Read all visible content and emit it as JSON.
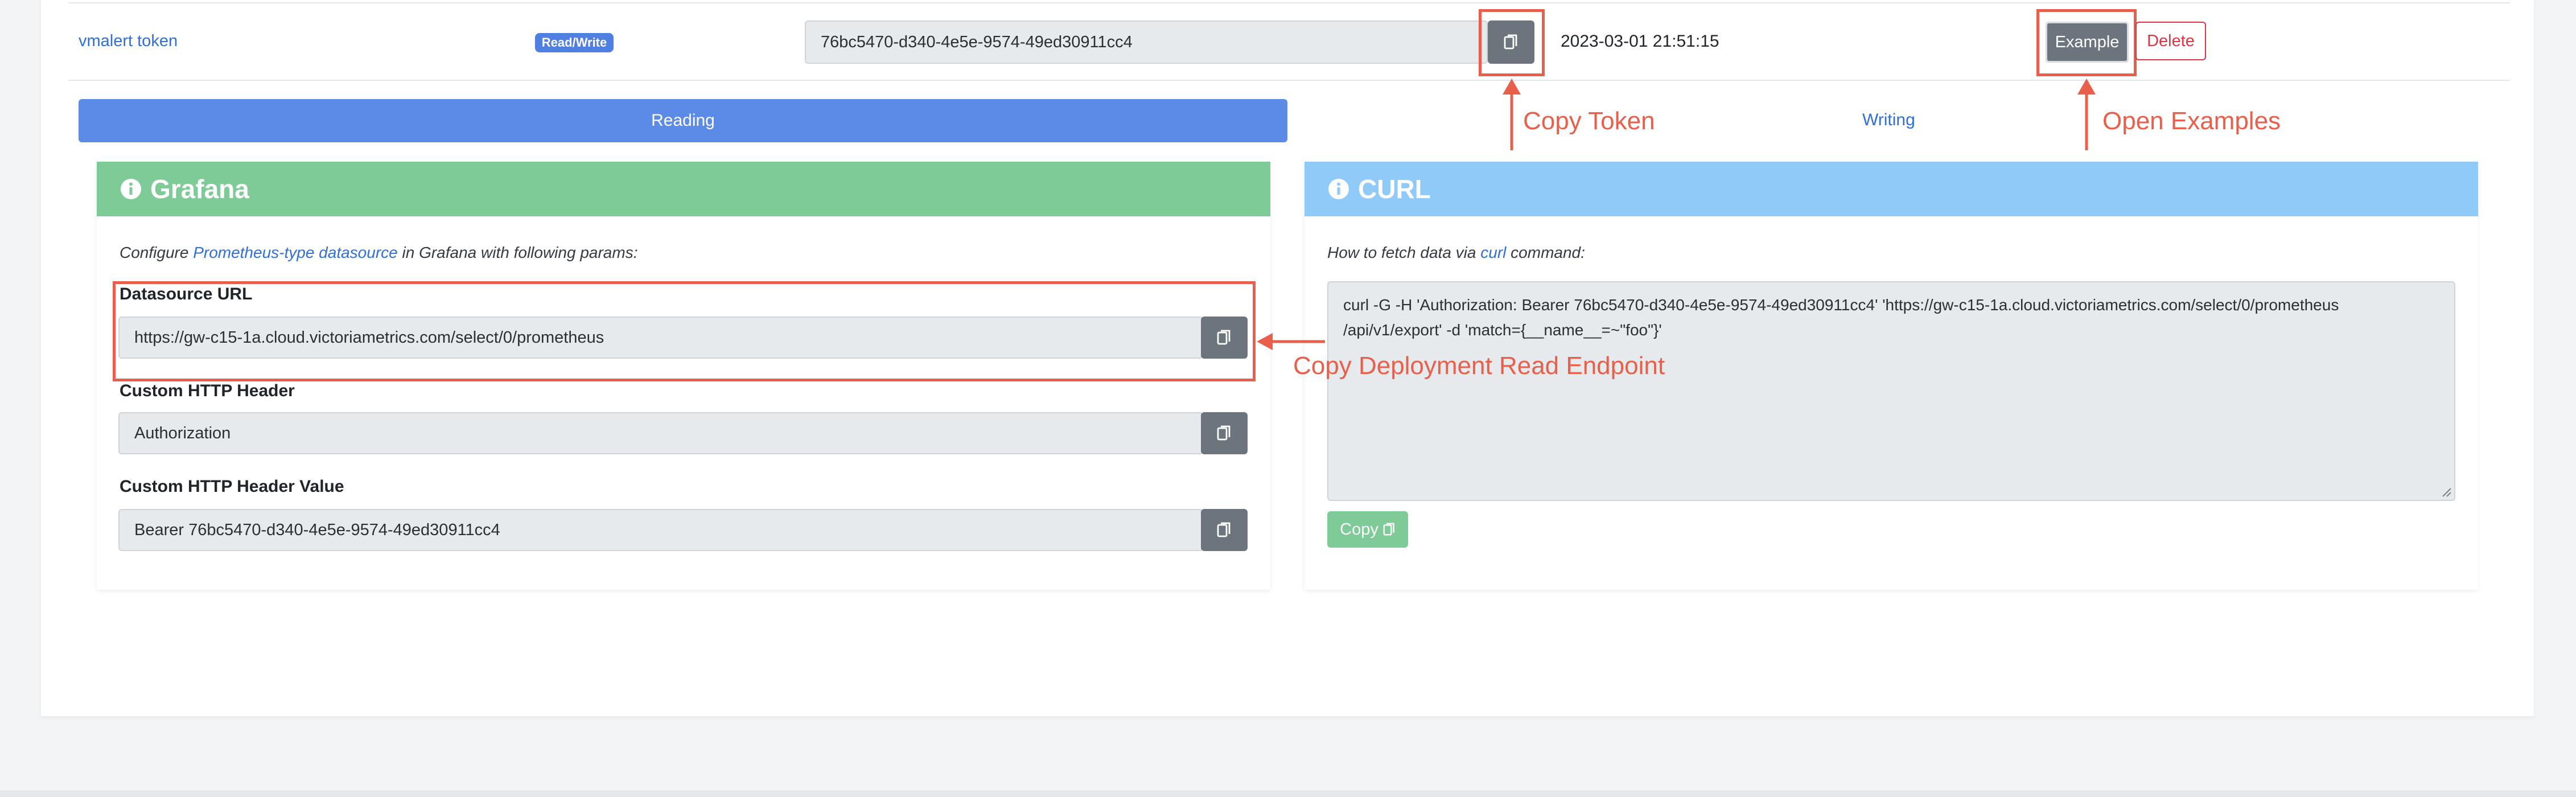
{
  "token_row": {
    "name": "vmalert token",
    "access_badge": "Read/Write",
    "token_value": "76bc5470-d340-4e5e-9574-49ed30911cc4",
    "created": "2023-03-01 21:51:15",
    "example_label": "Example",
    "delete_label": "Delete"
  },
  "tabs": {
    "reading": "Reading",
    "writing": "Writing"
  },
  "grafana": {
    "title": "Grafana",
    "desc_prefix": "Configure ",
    "desc_link": "Prometheus-type datasource",
    "desc_suffix": " in Grafana with following params:",
    "fields": [
      {
        "label": "Datasource URL",
        "value": "https://gw-c15-1a.cloud.victoriametrics.com/select/0/prometheus"
      },
      {
        "label": "Custom HTTP Header",
        "value": "Authorization"
      },
      {
        "label": "Custom HTTP Header Value",
        "value": "Bearer 76bc5470-d340-4e5e-9574-49ed30911cc4"
      }
    ]
  },
  "curl": {
    "title": "CURL",
    "desc_prefix": "How to fetch data via ",
    "desc_link": "curl",
    "desc_suffix": " command:",
    "command_line1": "curl -G -H 'Authorization: Bearer 76bc5470-d340-4e5e-9574-49ed30911cc4' 'https://gw-c15-1a.cloud.victoriametrics.com/select/0/prometheus",
    "command_line2": "/api/v1/export' -d 'match={__name__=~\"foo\"}'",
    "copy_label": "Copy"
  },
  "annotations": {
    "copy_token": "Copy Token",
    "open_examples": "Open Examples",
    "copy_read_endpoint": "Copy Deployment Read Endpoint"
  },
  "colors": {
    "accent_blue": "#5b8be6",
    "grafana_green": "#7ecb97",
    "curl_blue": "#90caf9",
    "annotation_red": "#e8604c"
  }
}
